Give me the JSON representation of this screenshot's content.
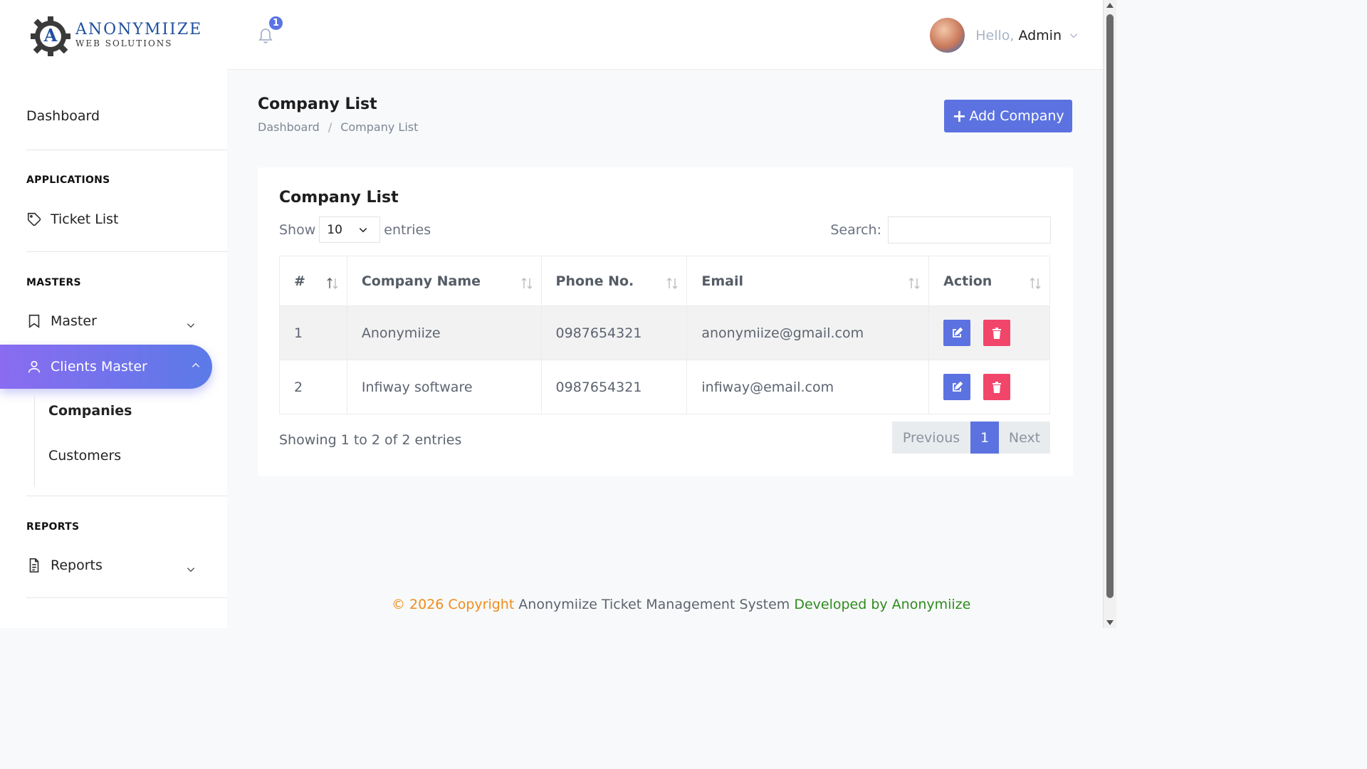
{
  "brand": {
    "name": "ANONYMIIZE",
    "tagline": "WEB SOLUTIONS",
    "color": "#1f4f9e"
  },
  "sidebar": {
    "dashboard": "Dashboard",
    "sections": {
      "applications": "APPLICATIONS",
      "masters": "MASTERS",
      "reports": "REPORTS"
    },
    "items": {
      "ticket_list": "Ticket List",
      "master": "Master",
      "clients_master": "Clients Master",
      "companies": "Companies",
      "customers": "Customers",
      "reports": "Reports"
    },
    "active_gradient": [
      "#8a6cf0",
      "#5b7ae8"
    ]
  },
  "header": {
    "notification_count": "1",
    "greeting": "Hello,",
    "user_name": "Admin"
  },
  "page": {
    "title": "Company List",
    "breadcrumb": [
      "Dashboard",
      "Company List"
    ],
    "add_button": "Add Company"
  },
  "card": {
    "title": "Company List",
    "show_label": "Show",
    "entries_value": "10",
    "entries_label": "entries",
    "search_label": "Search:",
    "search_value": ""
  },
  "table": {
    "columns": [
      "#",
      "Company Name",
      "Phone No.",
      "Email",
      "Action"
    ],
    "rows": [
      {
        "num": "1",
        "name": "Anonymiize",
        "phone": "0987654321",
        "email": "anonymiize@gmail.com"
      },
      {
        "num": "2",
        "name": "Infiway software",
        "phone": "0987654321",
        "email": "infiway@email.com"
      }
    ]
  },
  "pagination": {
    "info": "Showing 1 to 2 of 2 entries",
    "previous": "Previous",
    "current": "1",
    "next": "Next"
  },
  "footer": {
    "copyright": "© 2026 Copyright",
    "system": "Anonymiize Ticket Management System",
    "developer": "Developed by Anonymiize"
  },
  "colors": {
    "primary": "#5b72e0",
    "danger": "#f2456a",
    "footer_orange": "#f08c1a",
    "footer_green": "#2e8b1e"
  }
}
